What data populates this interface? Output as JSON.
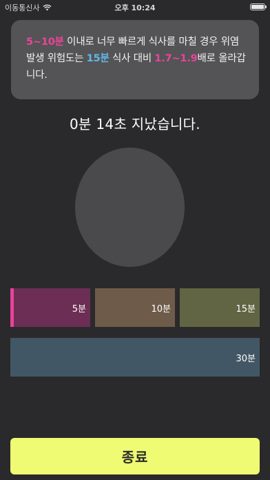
{
  "status_bar": {
    "carrier": "이동통신사",
    "time": "오후 10:24"
  },
  "info": {
    "p1": "5~10분",
    "t1": " 이내로 너무 빠르게 식사를 마칠 경우 위염 발생 위험도는 ",
    "p2": "15분",
    "t2": " 식사 대비 ",
    "p3": "1.7~1.9",
    "t3": "배로 올라갑니다."
  },
  "timer": {
    "elapsed_text": "0분 14초 지났습니다."
  },
  "segments": [
    {
      "label": "5분",
      "color": "#6c2e55",
      "active": true
    },
    {
      "label": "10분",
      "color": "#6f5b4a",
      "active": false
    },
    {
      "label": "15분",
      "color": "#616543",
      "active": false
    },
    {
      "label": "30분",
      "color": "#425765",
      "active": false
    }
  ],
  "colors": {
    "highlight_pink": "#ea4598",
    "highlight_blue": "#62b8e8",
    "button": "#effb72"
  },
  "icons": [
    "wifi-icon",
    "battery-icon"
  ],
  "end_button": {
    "label": "종료"
  }
}
